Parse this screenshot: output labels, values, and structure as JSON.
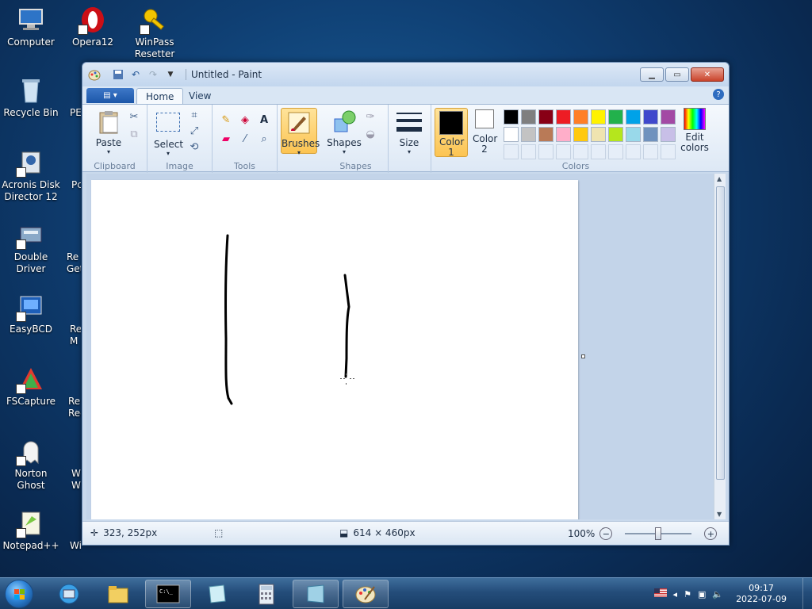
{
  "desktop": {
    "icons": [
      {
        "label": "Computer"
      },
      {
        "label": "Opera12"
      },
      {
        "label": "WinPass Resetter"
      },
      {
        "label": "Recycle Bin"
      },
      {
        "label": "PE"
      },
      {
        "label": "Acronis Disk Director 12"
      },
      {
        "label": "Pc"
      },
      {
        "label": "Double Driver"
      },
      {
        "label": "Re Get"
      },
      {
        "label": "EasyBCD"
      },
      {
        "label": "Re M"
      },
      {
        "label": "FSCapture"
      },
      {
        "label": "Re Rec"
      },
      {
        "label": "Norton Ghost"
      },
      {
        "label": "W W"
      },
      {
        "label": "Notepad++"
      },
      {
        "label": "Win..."
      }
    ]
  },
  "window": {
    "title": "Untitled - Paint",
    "tabs": [
      "Home",
      "View"
    ],
    "active_tab": "Home",
    "groups": {
      "clipboard": {
        "label": "Clipboard",
        "paste": "Paste"
      },
      "image": {
        "label": "Image",
        "select": "Select"
      },
      "tools": {
        "label": "Tools"
      },
      "brushes": {
        "label": "Brushes"
      },
      "shapes": {
        "label": "Shapes",
        "shapes_btn": "Shapes"
      },
      "size": {
        "label": "Size"
      },
      "colors": {
        "label": "Colors",
        "color1": "Color 1",
        "color2": "Color 2",
        "edit_colors": "Edit colors",
        "color1_value": "#000000",
        "color2_value": "#ffffff",
        "palette_row1": [
          "#000000",
          "#7f7f7f",
          "#880015",
          "#ed1c24",
          "#ff7f27",
          "#fff200",
          "#22b14c",
          "#00a2e8",
          "#3f48cc",
          "#a349a4"
        ],
        "palette_row2": [
          "#ffffff",
          "#c3c3c3",
          "#b97a57",
          "#ffaec9",
          "#ffc90e",
          "#efe4b0",
          "#b5e61d",
          "#99d9ea",
          "#7092be",
          "#c8bfe7"
        ]
      }
    },
    "status": {
      "cursor_pos": "323, 252px",
      "canvas_size": "614 × 460px",
      "zoom": "100%"
    }
  },
  "taskbar": {
    "clock_time": "09:17",
    "clock_date": "2022-07-09"
  }
}
